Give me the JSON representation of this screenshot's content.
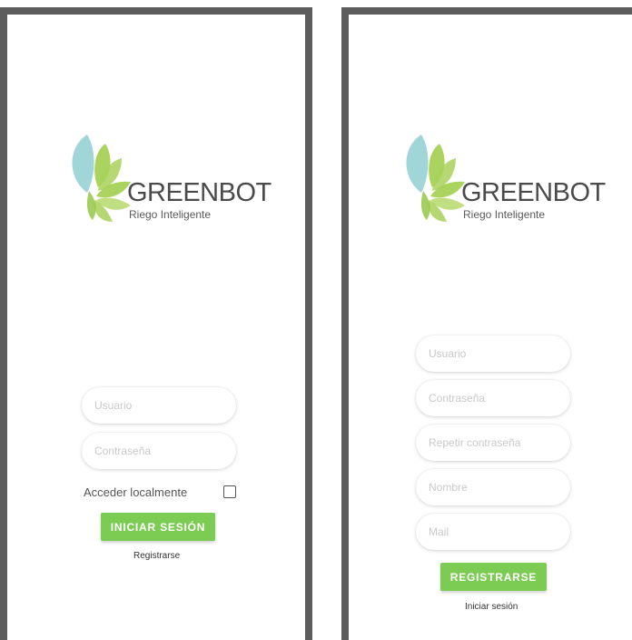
{
  "brand": {
    "name": "GREENBOT",
    "tagline": "Riego Inteligente",
    "colors": {
      "leaf_blue": "#8fcfd1",
      "leaf_green": "#9bcb43",
      "button_green": "#7ccb52"
    }
  },
  "login": {
    "username_placeholder": "Usuario",
    "password_placeholder": "Contraseña",
    "local_access_label": "Acceder localmente",
    "local_access_checked": false,
    "submit_label": "INICIAR SESIÓN",
    "register_link": "Registrarse"
  },
  "register": {
    "username_placeholder": "Usuario",
    "password_placeholder": "Contraseña",
    "repeat_password_placeholder": "Repetir contraseña",
    "name_placeholder": "Nombre",
    "mail_placeholder": "Mail",
    "submit_label": "REGISTRARSE",
    "login_link": "Iniciar sesión"
  }
}
